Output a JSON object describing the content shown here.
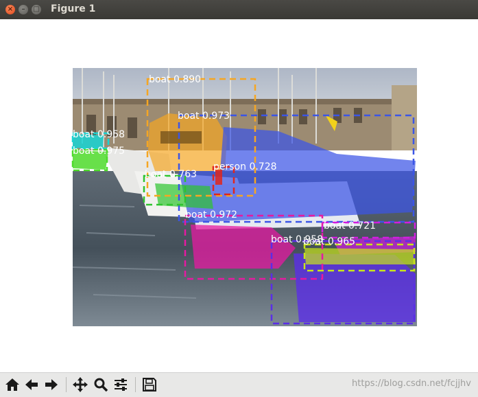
{
  "window": {
    "title": "Figure 1",
    "controls": {
      "close": "×",
      "minimize": "–",
      "maximize": "□"
    }
  },
  "detections": [
    {
      "class": "boat",
      "score": "0.890",
      "label": "boat 0.890",
      "color": "#f5a623"
    },
    {
      "class": "boat",
      "score": "0.973",
      "label": "boat 0.973",
      "color": "#3b55e6"
    },
    {
      "class": "boat",
      "score": "0.958",
      "label": "boat 0.958",
      "color": "#17d4d4"
    },
    {
      "class": "boat",
      "score": "0.975",
      "label": "boat 0.975",
      "color": "#4ddb2a"
    },
    {
      "class": "person",
      "score": "0.728",
      "label": "person 0.728",
      "color": "#e0261c"
    },
    {
      "class": "boat",
      "score": "0.763",
      "label": "boat 0.763",
      "color": "#2ec42e"
    },
    {
      "class": "boat",
      "score": "0.972",
      "label": "boat 0.972",
      "color": "#e51aa1"
    },
    {
      "class": "boat",
      "score": "0.721",
      "label": "boat 0.721",
      "color": "#d11ee0"
    },
    {
      "class": "boat",
      "score": "0.958",
      "label": "boat 0.958",
      "color": "#5b2ee6"
    },
    {
      "class": "boat",
      "score": "0.965",
      "label": "boat 0.965",
      "color": "#c8e61a"
    }
  ],
  "toolbar": {
    "buttons": [
      {
        "name": "home-button",
        "icon": "home-icon"
      },
      {
        "name": "back-button",
        "icon": "arrow-left-icon"
      },
      {
        "name": "forward-button",
        "icon": "arrow-right-icon"
      },
      {
        "name": "pan-button",
        "icon": "move-icon"
      },
      {
        "name": "zoom-button",
        "icon": "magnifier-icon"
      },
      {
        "name": "configure-subplots-button",
        "icon": "sliders-icon"
      },
      {
        "name": "save-button",
        "icon": "floppy-disk-icon"
      }
    ]
  },
  "watermark": "https://blog.csdn.net/fcjjhv"
}
